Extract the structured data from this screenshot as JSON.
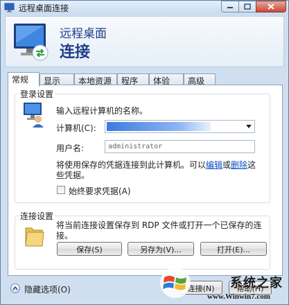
{
  "titlebar": {
    "title": "远程桌面连接"
  },
  "header": {
    "line1": "远程桌面",
    "line2": "连接"
  },
  "tabs": [
    {
      "label": "常规"
    },
    {
      "label": "显示"
    },
    {
      "label": "本地资源"
    },
    {
      "label": "程序"
    },
    {
      "label": "体验"
    },
    {
      "label": "高级"
    }
  ],
  "login": {
    "group_title": "登录设置",
    "instruction": "输入远程计算机的名称。",
    "computer_label": "计算机(C):",
    "username_label": "用户名:",
    "username_value": "administrator",
    "saved_text_1": "将使用保存的凭据连接到此计算机。可以",
    "edit_link": "编辑",
    "or_text": "或",
    "delete_link": "删除",
    "saved_text_2": "这",
    "saved_text_3": "些凭据。",
    "always_ask_label": "始终要求凭据(A)",
    "always_ask_checked": false
  },
  "connection": {
    "group_title": "连接设置",
    "description_1": "将当前连接设置保存到 RDP 文件或打开一个已保存的连",
    "description_2": "接。",
    "save_button": "保存(S)",
    "save_as_button": "另存为(V)...",
    "open_button": "打开(E)..."
  },
  "footer": {
    "hide_options_label": "隐藏选项(O)",
    "connect_button": "连接(N)",
    "help_button": "帮助(H)"
  },
  "watermark": {
    "brand": "系统之家",
    "url": "www.Winwin7.com"
  }
}
